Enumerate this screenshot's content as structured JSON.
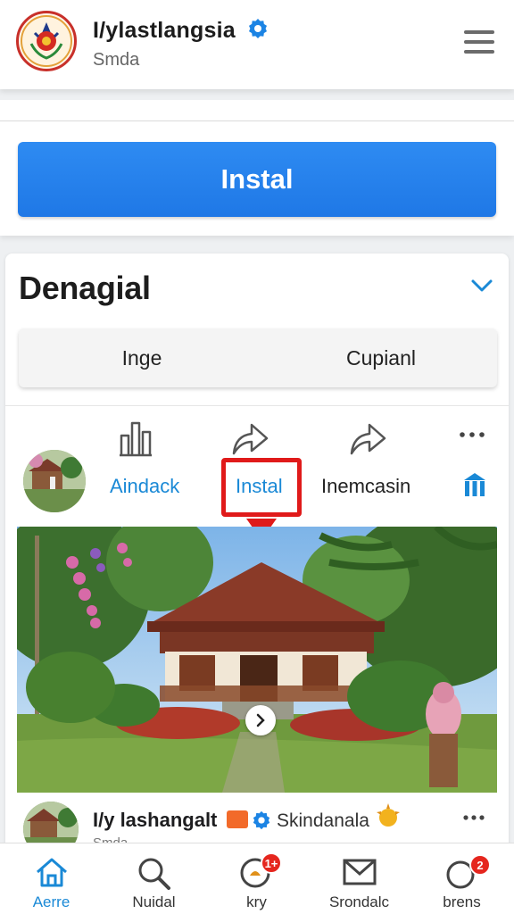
{
  "header": {
    "title": "I/ylastlangsia",
    "subtitle": "Smda",
    "logo_icon": "emblem-logo",
    "verified_icon": "verified-badge-icon",
    "menu_icon": "hamburger-menu-icon"
  },
  "install_button": {
    "label": "Instal",
    "color": "#2484ee"
  },
  "card": {
    "title": "Denagial",
    "toggle": [
      "Inge",
      "Cupianl"
    ],
    "actions": {
      "like_label": "Aindack",
      "install_label": "Instal",
      "share_label": "Inemcasin"
    },
    "highlight_color": "#e01a1a"
  },
  "post2": {
    "name": "I/y lashangalt",
    "extra": "Skindanala",
    "sub": "Smda"
  },
  "bottom_nav": [
    {
      "label": "Aerre",
      "icon": "home-icon",
      "active": true
    },
    {
      "label": "Nuidal",
      "icon": "search-icon"
    },
    {
      "label": "kry",
      "icon": "notification-icon",
      "badge": "1+"
    },
    {
      "label": "Srondalc",
      "icon": "mail-icon"
    },
    {
      "label": "brens",
      "icon": "circle-icon",
      "badge": "2"
    }
  ],
  "colors": {
    "accent": "#1a89d6",
    "badge": "#e5261e"
  }
}
